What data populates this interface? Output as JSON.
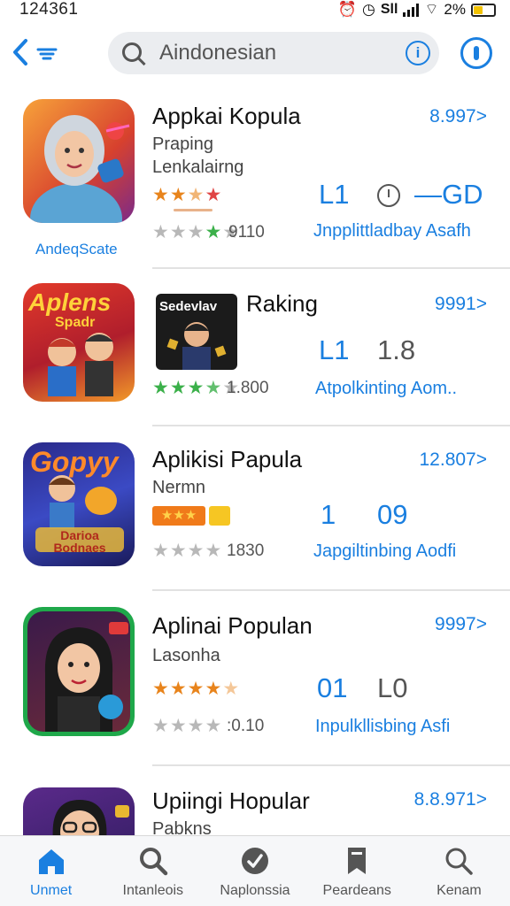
{
  "status_bar": {
    "time": "124361",
    "carrier": "Sll",
    "battery": "2%"
  },
  "search": {
    "query": "Aindonesian"
  },
  "apps": [
    {
      "title": "Appkai Kopula",
      "subtitle_1": "Praping",
      "subtitle_2": "Lenkalairng",
      "price": "8.997>",
      "stat_1": "L1",
      "stat_3": "—GD",
      "rating_count": "9110",
      "link_text": "Jnpplittladbay Asafh",
      "icon_caption": "AndeqScate"
    },
    {
      "title": "Raking",
      "price": "9991>",
      "stat_1": "L1",
      "stat_2": "1.8",
      "rating_count": "1.800",
      "link_text": "Atpolkinting Aom..",
      "icon_text_top": "Aplens",
      "icon_text_sub": "Spadr",
      "thumb_text": "Sedevlav"
    },
    {
      "title": "Aplikisi Papula",
      "subtitle_1": "Nermn",
      "price": "12.807>",
      "stat_1": "1",
      "stat_2": "09",
      "rating_count": "1830",
      "link_text": "Japgiltinbing Aodfi",
      "icon_text_top": "Gopyy",
      "icon_text_sub": "Darioa Bodnaes"
    },
    {
      "title": "Aplinai Populan",
      "subtitle_1": "Lasonha",
      "price": "9997>",
      "stat_1": "01",
      "stat_2": "L0",
      "rating_count": ":0.10",
      "link_text": "Inpulkllisbing Asfi"
    },
    {
      "title": "Upiingi Hopular",
      "subtitle_1": "Pabkns",
      "price": "8.8.971>"
    }
  ],
  "tabs": [
    {
      "label": "Unmet",
      "icon": "home-icon"
    },
    {
      "label": "Intanleois",
      "icon": "search-icon"
    },
    {
      "label": "Naplonssia",
      "icon": "compass-icon"
    },
    {
      "label": "Peardeans",
      "icon": "bookmark-icon"
    },
    {
      "label": "Kenam",
      "icon": "search-icon"
    }
  ],
  "colors": {
    "accent": "#1a7fe0",
    "star_orange": "#e8841c",
    "star_green": "#3bb04a",
    "tabbar_bg": "#f6f7f9"
  }
}
